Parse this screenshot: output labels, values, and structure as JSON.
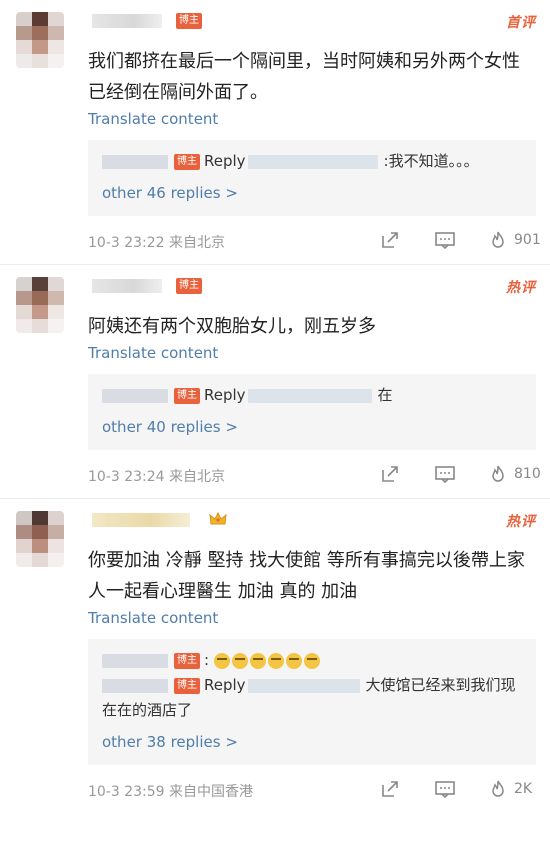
{
  "comments": [
    {
      "tag": "首评",
      "host_badge": "博主",
      "text": "我们都挤在最后一个隔间里，当时阿姨和另外两个女性已经倒在隔间外面了。",
      "translate": "Translate content",
      "reply": {
        "host_badge": "博主",
        "prefix": "Reply",
        "text": ":我不知道。。。"
      },
      "other_replies": "other 46 replies >",
      "time": "10-3 23:22 来自北京",
      "likes": "901"
    },
    {
      "tag": "热评",
      "host_badge": "博主",
      "text": "阿姨还有两个双胞胎女儿，刚五岁多",
      "translate": "Translate content",
      "reply": {
        "host_badge": "博主",
        "prefix": "Reply",
        "text": "在"
      },
      "other_replies": "other 40 replies >",
      "time": "10-3 23:24 来自北京",
      "likes": "810"
    },
    {
      "tag": "热评",
      "text": "你要加油 冷靜 堅持 找大使館 等所有事搞完以後帶上家人一起看心理醫生 加油 真的 加油",
      "translate": "Translate content",
      "reply_a": {
        "host_badge": "博主",
        "text": ":"
      },
      "reply": {
        "host_badge": "博主",
        "prefix": "Reply",
        "text": "大使馆已经来到我们现在在的酒店了"
      },
      "other_replies": "other 38 replies >",
      "time": "10-3 23:59 来自中国香港",
      "likes": "2K"
    }
  ],
  "colors": {
    "accent": "#e8633d",
    "link": "#4f7dac"
  },
  "icons": [
    "share-icon",
    "comment-icon",
    "like-icon",
    "crown-icon",
    "crying-emoji-icon"
  ]
}
